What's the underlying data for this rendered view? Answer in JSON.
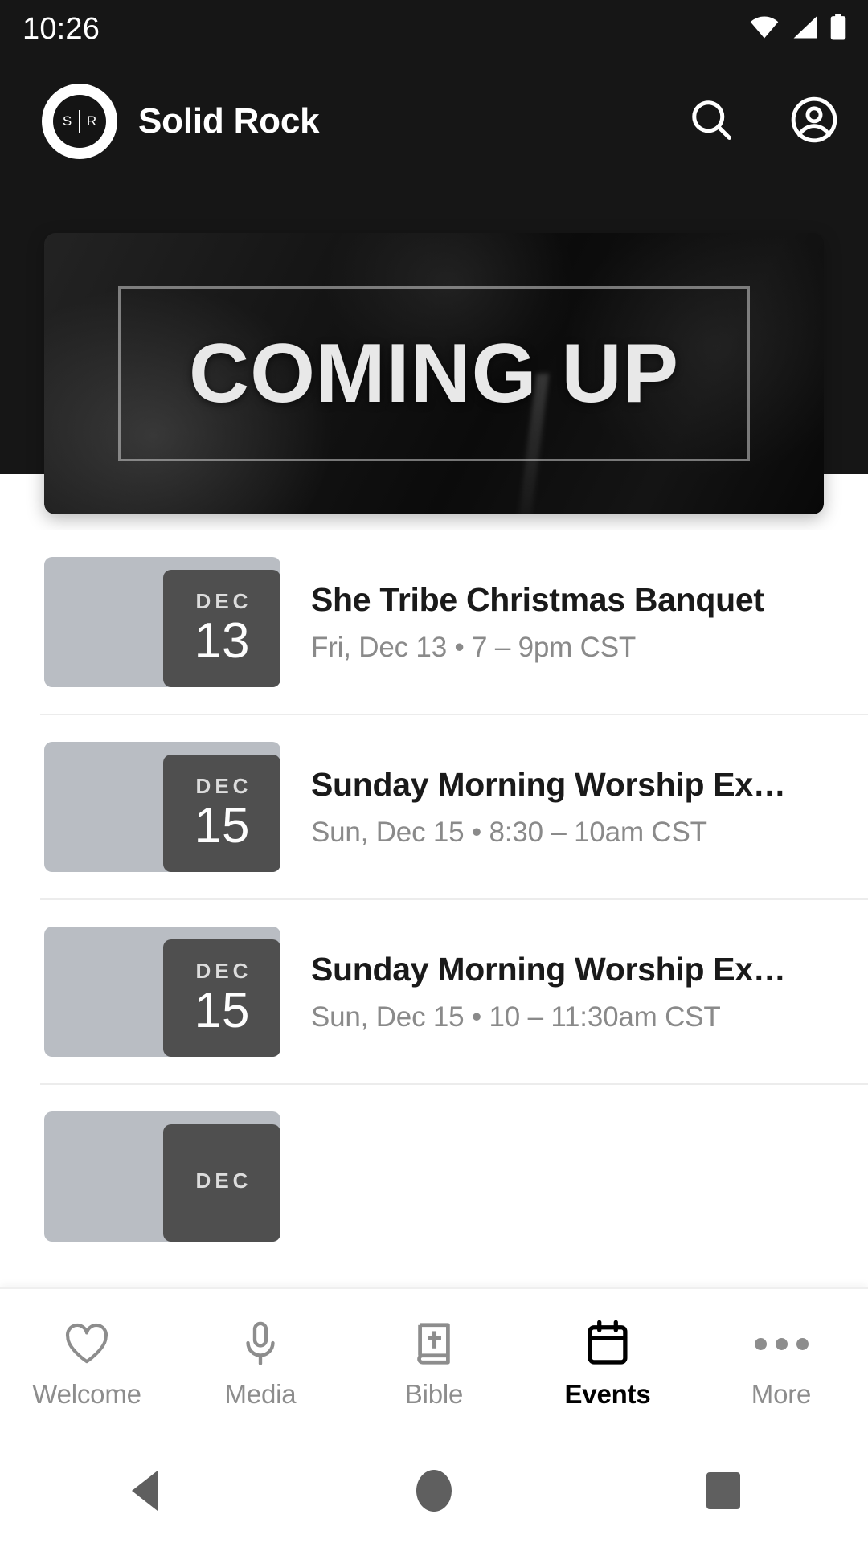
{
  "status_bar": {
    "clock": "10:26",
    "icons": [
      "wifi-icon",
      "cellular-signal-icon",
      "battery-icon"
    ]
  },
  "app_bar": {
    "logo_text": "S R",
    "title": "Solid Rock",
    "actions": [
      {
        "name": "search-icon",
        "label": "Search"
      },
      {
        "name": "account-icon",
        "label": "Account"
      }
    ]
  },
  "hero": {
    "headline": "COMING UP"
  },
  "events": [
    {
      "month": "DEC",
      "day": "13",
      "title": "She Tribe Christmas Banquet",
      "when": "Fri, Dec 13 • 7 – 9pm CST"
    },
    {
      "month": "DEC",
      "day": "15",
      "title": "Sunday Morning Worship Ex…",
      "when": "Sun, Dec 15 • 8:30 – 10am CST"
    },
    {
      "month": "DEC",
      "day": "15",
      "title": "Sunday Morning Worship Ex…",
      "when": "Sun, Dec 15 • 10 – 11:30am CST"
    },
    {
      "month": "DEC",
      "day": "",
      "title": "",
      "when": ""
    }
  ],
  "bottom_nav": {
    "active": "Events",
    "items": [
      {
        "label": "Welcome",
        "icon": "heart-icon"
      },
      {
        "label": "Media",
        "icon": "microphone-icon"
      },
      {
        "label": "Bible",
        "icon": "book-cross-icon"
      },
      {
        "label": "Events",
        "icon": "calendar-icon"
      },
      {
        "label": "More",
        "icon": "ellipsis-icon"
      }
    ]
  },
  "system_nav": {
    "back": "Back",
    "home": "Home",
    "recents": "Recent apps"
  },
  "colors": {
    "header_bg": "#161616",
    "page_bg": "#ffffff",
    "accent_active": "#000000",
    "muted_text": "#8a8a8a",
    "thumb_gray": "#b9bdc3",
    "badge_gray": "#4f4f4f"
  }
}
